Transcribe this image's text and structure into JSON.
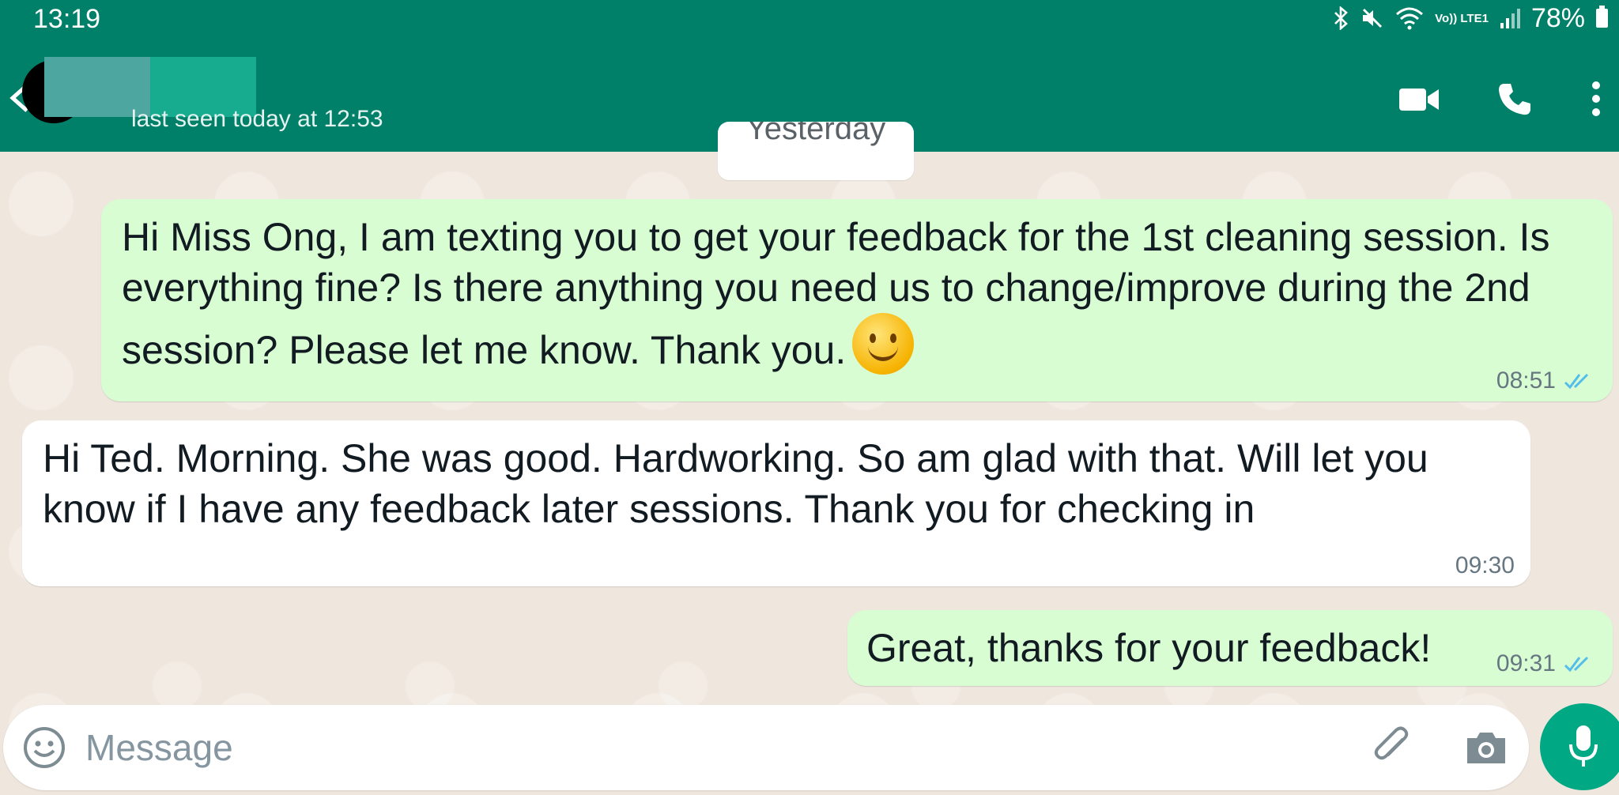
{
  "status_bar": {
    "time": "13:19",
    "network_label": "Vo)) LTE1",
    "battery": "78%"
  },
  "header": {
    "last_seen": "last seen today at 12:53",
    "colors": {
      "bar": "#008069",
      "redaction_a": "#4ea6a1",
      "redaction_b": "#17ab8f"
    },
    "icons": [
      "back-arrow-icon",
      "video-call-icon",
      "phone-icon",
      "more-options-icon"
    ]
  },
  "chat": {
    "date_separator": "Yesterday",
    "messages": [
      {
        "direction": "outgoing",
        "text": "Hi Miss Ong, I am texting you to get your feedback for the 1st cleaning session. Is everything fine? Is there anything you need us to change/improve during the 2nd session? Please let me know. Thank you.",
        "emoji": "smiling-face-emoji",
        "time": "08:51",
        "status": "read"
      },
      {
        "direction": "incoming",
        "text": "Hi Ted. Morning. She was good. Hardworking. So am glad with that. Will let you know if I have any feedback later sessions. Thank you for checking in",
        "time": "09:30"
      },
      {
        "direction": "outgoing",
        "text": "Great, thanks for your feedback!",
        "time": "09:31",
        "status": "read"
      }
    ],
    "colors": {
      "outgoing_bubble": "#d9fdd3",
      "incoming_bubble": "#ffffff",
      "read_ticks": "#53bdeb",
      "wallpaper": "#efe7de"
    }
  },
  "compose": {
    "placeholder": "Message",
    "icons": [
      "emoji-icon",
      "attach-icon",
      "camera-icon",
      "mic-icon"
    ],
    "mic_button_color": "#00a884"
  }
}
